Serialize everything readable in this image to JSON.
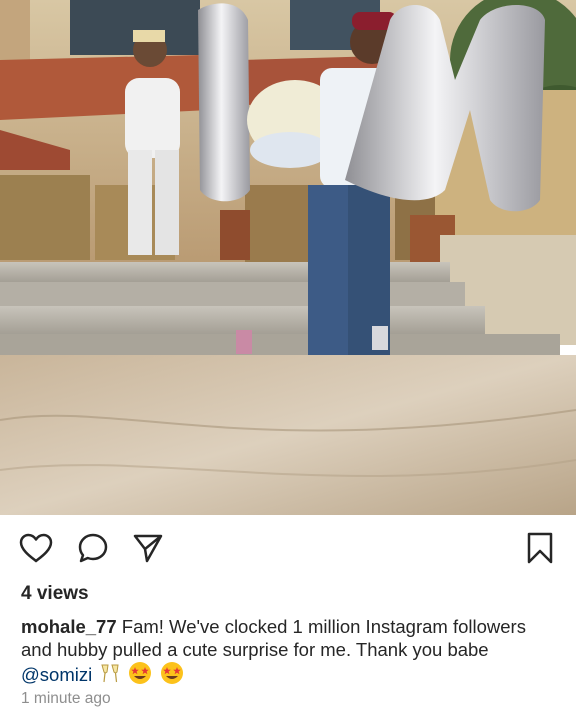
{
  "post": {
    "views_text": "4 views",
    "username": "mohale_77",
    "caption_text": "Fam! We've clocked 1 million Instagram followers and hubby pulled a cute surprise for me. Thank you babe ",
    "mention": "@somizi",
    "timestamp": "1 minute ago"
  },
  "icons": {
    "like": "heart-icon",
    "comment": "comment-bubble-icon",
    "share": "paper-plane-icon",
    "save": "bookmark-icon"
  },
  "colors": {
    "text": "#262626",
    "mention": "#003569",
    "timestamp": "#8e8e8e",
    "background": "#ffffff"
  }
}
